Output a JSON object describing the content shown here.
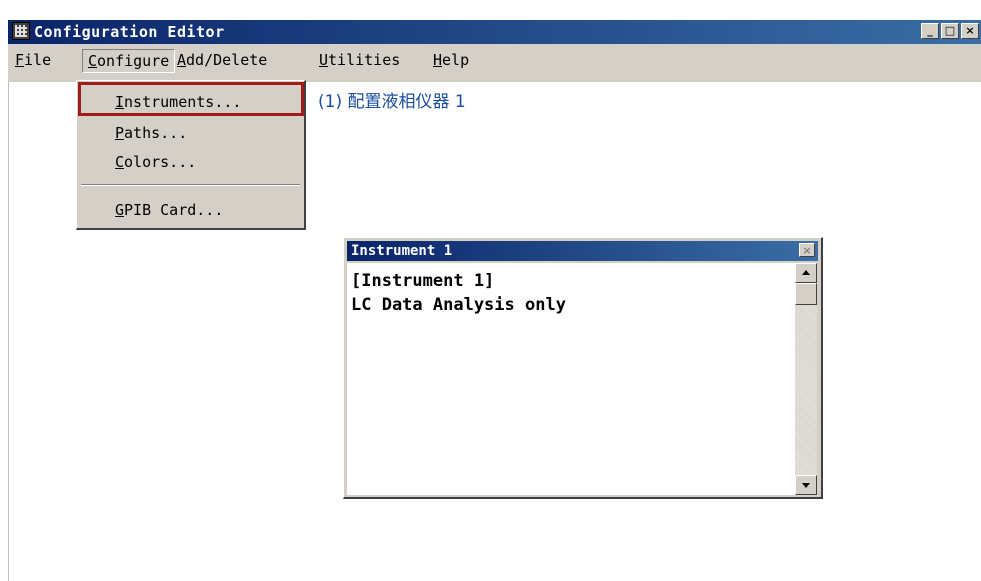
{
  "window": {
    "title": "Configuration Editor",
    "icon": "instrument-grid-icon",
    "controls": {
      "minimize": "_",
      "maximize": "□",
      "close": "×"
    }
  },
  "menubar": {
    "file": {
      "u": "F",
      "rest": "ile"
    },
    "configure": {
      "u": "C",
      "rest": "onfigure"
    },
    "add_delete": {
      "u": "A",
      "rest": "dd/Delete"
    },
    "utilities": {
      "u": "U",
      "rest": "tilities"
    },
    "help": {
      "u": "H",
      "rest": "elp"
    }
  },
  "configure_menu": {
    "instruments": {
      "u": "I",
      "rest": "nstruments..."
    },
    "paths": {
      "u": "P",
      "rest": "aths..."
    },
    "colors": {
      "u": "C",
      "rest": "olors..."
    },
    "gpib": {
      "u": "G",
      "rest": "PIB Card..."
    }
  },
  "annotation": "(1) 配置液相仪器 1",
  "child_window": {
    "title": "Instrument 1",
    "close": "×",
    "lines": [
      "[Instrument 1]",
      "LC Data Analysis only"
    ]
  },
  "colors": {
    "title_bar": "#0a246a",
    "face": "#d4d0c8",
    "highlight_box": "#a01c1c",
    "annotation": "#1a4ca0"
  }
}
